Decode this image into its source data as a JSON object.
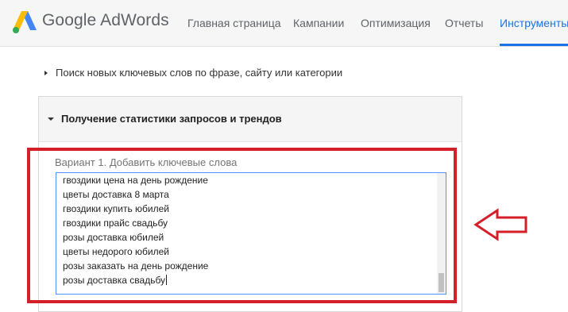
{
  "header": {
    "brand": "Google AdWords",
    "nav": [
      {
        "label": "Главная страница"
      },
      {
        "label": "Кампании"
      },
      {
        "label": "Оптимизация"
      },
      {
        "label": "Отчеты"
      },
      {
        "label": "Инструменты",
        "active": true
      }
    ]
  },
  "sections": {
    "search_new": "Поиск новых ключевых слов по фразе, сайту или категории",
    "stats_title": "Получение статистики запросов и трендов"
  },
  "option": {
    "label": "Вариант 1. Добавить ключевые слова",
    "keywords": [
      "гвоздики цена на день рождение",
      "цветы доставка 8 марта",
      "гвоздики купить юбилей",
      "гвоздики прайс свадьбу",
      "розы доставка юбилей",
      "цветы недорого юбилей",
      "розы заказать на день рождение",
      "розы доставка свадьбу"
    ]
  },
  "colors": {
    "accent": "#1a73e8",
    "highlight": "#d41f2b",
    "focus_border": "#4d90fe"
  },
  "icons": {
    "logo": "google-ads-logo",
    "arrow": "left-arrow-outline"
  }
}
